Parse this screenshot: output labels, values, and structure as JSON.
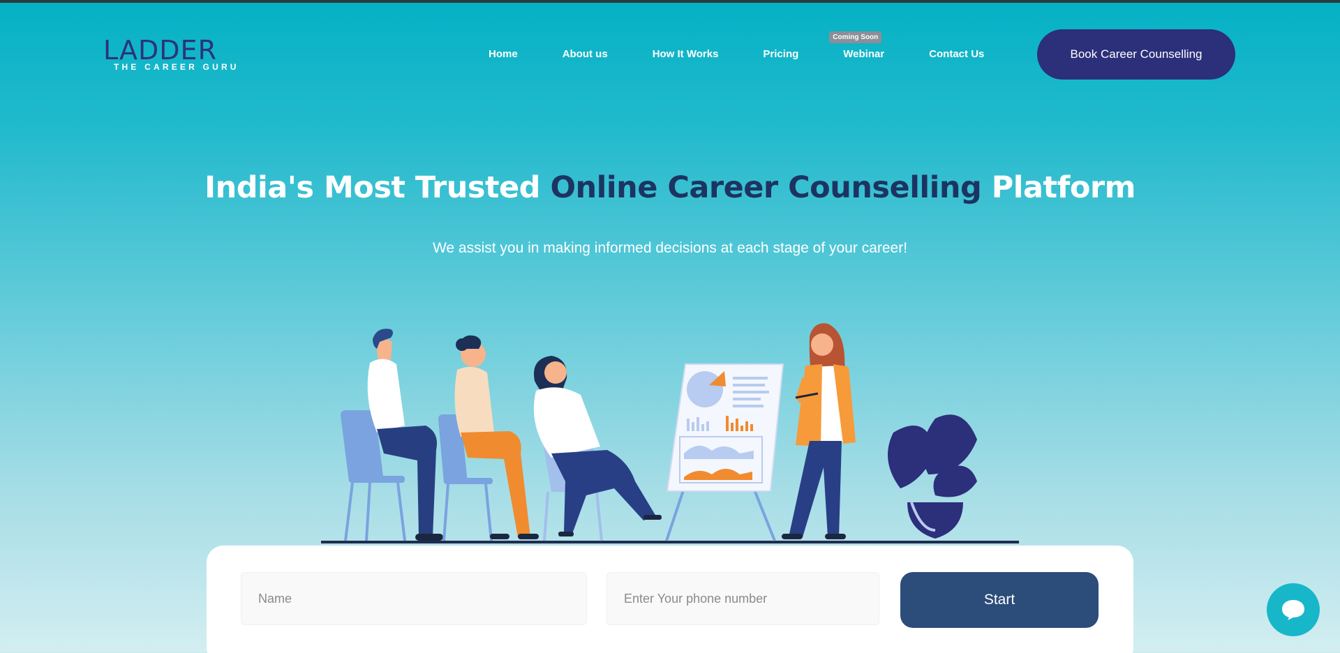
{
  "header": {
    "logo_text": "LADDER",
    "logo_tagline": "THE CAREER GURU",
    "nav": [
      {
        "label": "Home"
      },
      {
        "label": "About us"
      },
      {
        "label": "How It Works"
      },
      {
        "label": "Pricing"
      },
      {
        "label": "Webinar",
        "badge": "Coming Soon"
      },
      {
        "label": "Contact Us"
      }
    ],
    "cta_label": "Book Career Counselling"
  },
  "hero": {
    "title_part1": "India's Most Trusted ",
    "title_highlight": "Online Career Counselling",
    "title_part2": " Platform",
    "subtitle": "We assist you in making informed decisions at each stage of your career!"
  },
  "form": {
    "name_placeholder": "Name",
    "phone_placeholder": "Enter Your phone number",
    "submit_label": "Start"
  },
  "colors": {
    "brand_navy": "#2c2f7a",
    "accent_teal": "#05b1c4",
    "highlight_text": "#1c3462",
    "button_blue": "#2c4c7a"
  },
  "icons": {
    "chat": "chat-bubble-icon"
  }
}
